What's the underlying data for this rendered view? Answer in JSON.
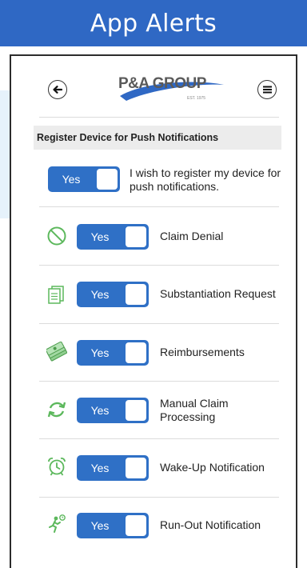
{
  "banner": {
    "title": "App Alerts"
  },
  "header": {
    "logo_text": "P&A GROUP",
    "logo_est": "EST. 1975"
  },
  "section": {
    "title": "Register Device for Push Notifications"
  },
  "register": {
    "toggle_label": "Yes",
    "text": "I wish to register my device for push notifications."
  },
  "rows": [
    {
      "icon": "no-entry-icon",
      "toggle_label": "Yes",
      "label": "Claim Denial"
    },
    {
      "icon": "document-icon",
      "toggle_label": "Yes",
      "label": "Substantiation Request"
    },
    {
      "icon": "money-stack-icon",
      "toggle_label": "Yes",
      "label": "Reimbursements"
    },
    {
      "icon": "sync-arrows-icon",
      "toggle_label": "Yes",
      "label": "Manual Claim Processing"
    },
    {
      "icon": "alarm-clock-icon",
      "toggle_label": "Yes",
      "label": "Wake-Up Notification"
    },
    {
      "icon": "runner-icon",
      "toggle_label": "Yes",
      "label": "Run-Out Notification"
    }
  ],
  "colors": {
    "brand_blue": "#2f68c4",
    "toggle_blue": "#2f70c6",
    "icon_green": "#5cb85c"
  }
}
